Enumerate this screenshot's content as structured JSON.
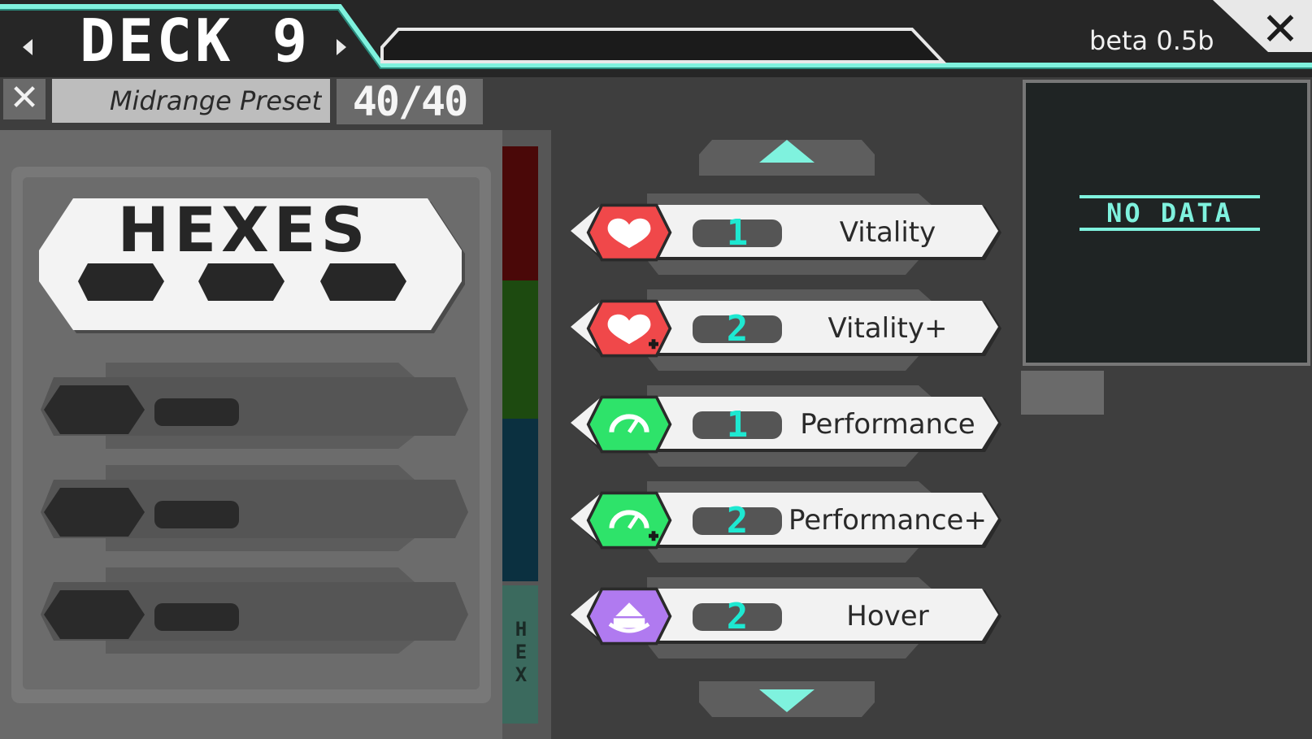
{
  "header": {
    "deck_title": "DECK 9",
    "version": "beta 0.5b",
    "close_icon": "close-icon",
    "prev_icon": "chevron-left-icon",
    "next_icon": "chevron-right-icon"
  },
  "deck": {
    "clear_label": "✕",
    "name": "Midrange Preset",
    "count": "40/40"
  },
  "hexes_panel": {
    "title": "HEXES"
  },
  "tabs": {
    "hex_label": "HEX"
  },
  "info": {
    "empty_text": "NO DATA"
  },
  "cards": [
    {
      "name": "Vitality",
      "count": "1",
      "icon": "heart-icon",
      "color": "#f0484a"
    },
    {
      "name": "Vitality+",
      "count": "2",
      "icon": "heart-plus-icon",
      "color": "#f0484a"
    },
    {
      "name": "Performance",
      "count": "1",
      "icon": "gauge-icon",
      "color": "#2ee36a"
    },
    {
      "name": "Performance+",
      "count": "2",
      "icon": "gauge-plus-icon",
      "color": "#2ee36a"
    },
    {
      "name": "Hover",
      "count": "2",
      "icon": "hover-icon",
      "color": "#b07af0"
    }
  ],
  "colors": {
    "accent": "#7ff2de",
    "background": "#3e3e3e"
  }
}
